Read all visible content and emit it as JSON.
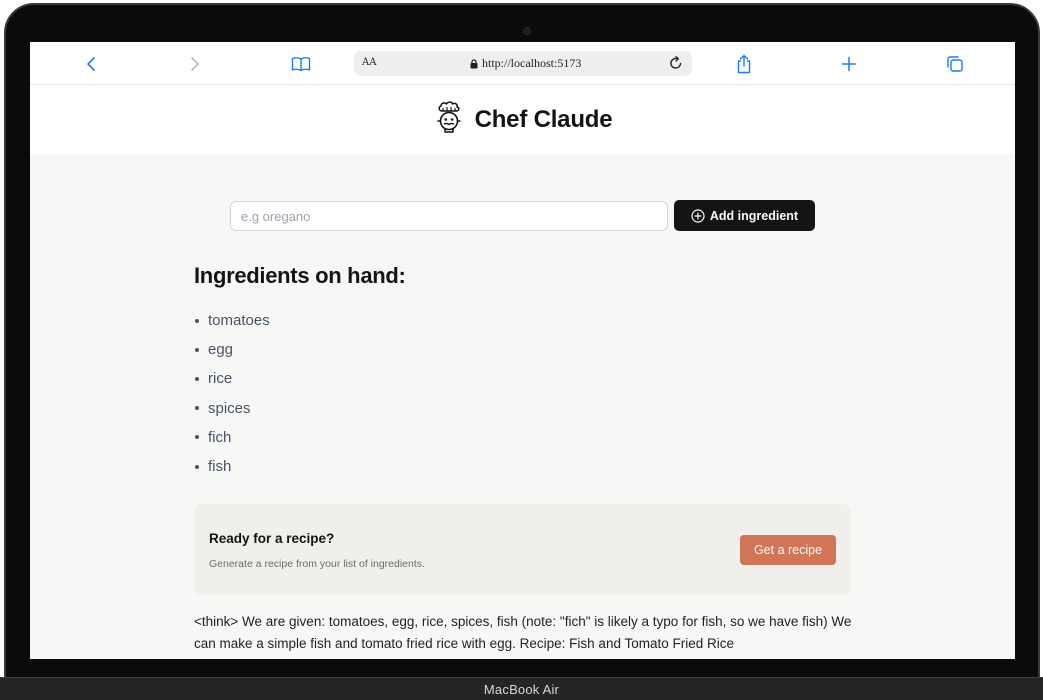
{
  "browser": {
    "address_bar_text_size": "AA",
    "url": "http://localhost:5173"
  },
  "header": {
    "title": "Chef Claude",
    "logo_icon": "chef-hat-face-icon"
  },
  "form": {
    "placeholder": "e.g oregano",
    "input_value": "",
    "add_button_label": "Add ingredient"
  },
  "ingredients": {
    "heading": "Ingredients on hand:",
    "items": [
      "tomatoes",
      "egg",
      "rice",
      "spices",
      "fich",
      "fish"
    ]
  },
  "recipe_cta": {
    "title": "Ready for a recipe?",
    "subtitle": "Generate a recipe from your list of ingredients.",
    "button_label": "Get a recipe"
  },
  "recipe_output": {
    "text": "<think> We are given: tomatoes, egg, rice, spices, fish (note: \"fich\" is likely a typo for fish, so we have fish) We can make a simple fish and tomato fried rice with egg. Recipe: Fish and Tomato Fried Rice"
  },
  "device": {
    "label": "MacBook Air"
  },
  "colors": {
    "accent": "#d17557",
    "dark_button": "#141413",
    "safari_blue": "#1a7cf5"
  }
}
